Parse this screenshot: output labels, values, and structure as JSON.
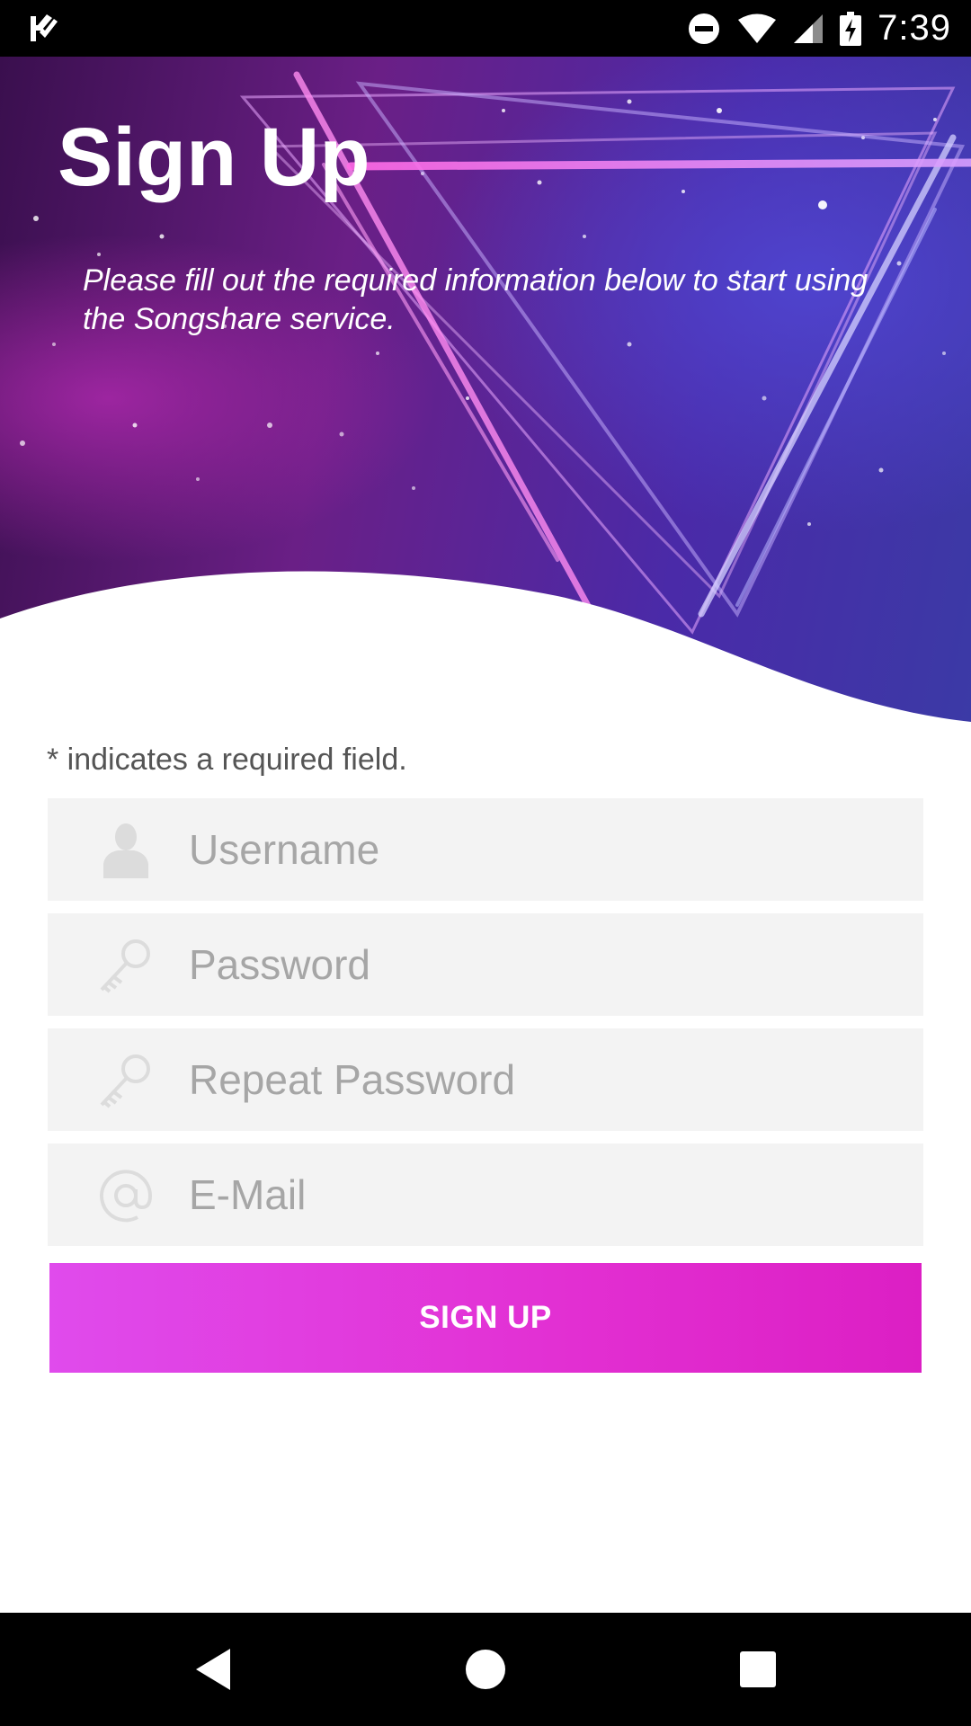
{
  "status_bar": {
    "time": "7:39",
    "icons": [
      "check-flag-icon",
      "do-not-disturb-icon",
      "wifi-icon",
      "cell-signal-icon",
      "battery-charging-icon"
    ]
  },
  "hero": {
    "title": "Sign Up",
    "subtitle": "Please fill out the required information below to start using the Songshare service."
  },
  "form": {
    "required_note": "* indicates a required field.",
    "username": {
      "placeholder": "Username",
      "value": "",
      "icon": "user-icon"
    },
    "password": {
      "placeholder": "Password",
      "value": "",
      "icon": "key-icon"
    },
    "repeat_password": {
      "placeholder": "Repeat Password",
      "value": "",
      "icon": "key-icon"
    },
    "email": {
      "placeholder": "E-Mail",
      "value": "",
      "icon": "at-sign-icon"
    },
    "submit_label": "SIGN UP"
  },
  "nav_bar": {
    "buttons": [
      "back-icon",
      "home-icon",
      "recents-icon"
    ]
  },
  "colors": {
    "accent": "#e23ad8",
    "field_bg": "#f3f3f3",
    "hero_purple": "#6a1f86",
    "hero_blue": "#4a2aa8"
  }
}
